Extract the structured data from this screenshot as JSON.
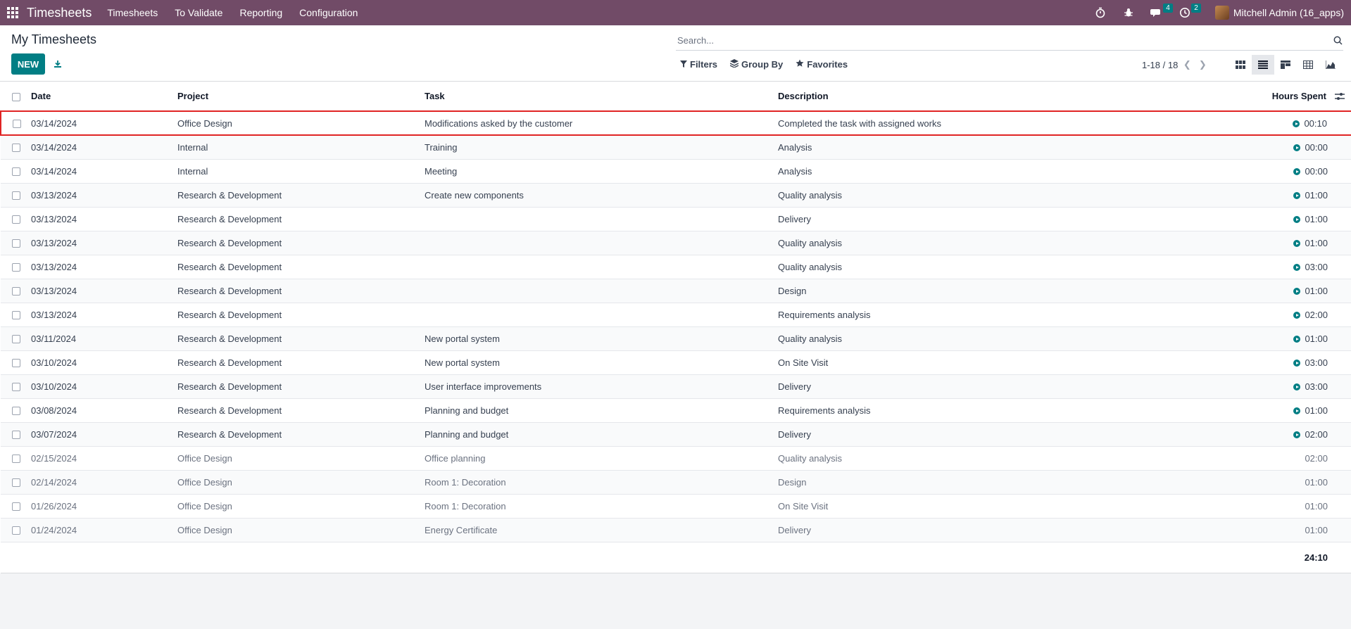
{
  "navbar": {
    "app_title": "Timesheets",
    "menu": [
      "Timesheets",
      "To Validate",
      "Reporting",
      "Configuration"
    ],
    "messages_count": "4",
    "activities_count": "2",
    "user_name": "Mitchell Admin (16_apps)"
  },
  "control": {
    "page_title": "My Timesheets",
    "new_label": "NEW",
    "search_placeholder": "Search...",
    "filters_label": "Filters",
    "groupby_label": "Group By",
    "favorites_label": "Favorites",
    "pager": "1-18 / 18"
  },
  "table": {
    "headers": {
      "date": "Date",
      "project": "Project",
      "task": "Task",
      "description": "Description",
      "hours": "Hours Spent"
    },
    "rows": [
      {
        "date": "03/14/2024",
        "project": "Office Design",
        "task": "Modifications asked by the customer",
        "description": "Completed the task with assigned works",
        "hours": "00:10",
        "timer": true,
        "selected": true
      },
      {
        "date": "03/14/2024",
        "project": "Internal",
        "task": "Training",
        "description": "Analysis",
        "hours": "00:00",
        "timer": true
      },
      {
        "date": "03/14/2024",
        "project": "Internal",
        "task": "Meeting",
        "description": "Analysis",
        "hours": "00:00",
        "timer": true
      },
      {
        "date": "03/13/2024",
        "project": "Research & Development",
        "task": "Create new components",
        "description": "Quality analysis",
        "hours": "01:00",
        "timer": true
      },
      {
        "date": "03/13/2024",
        "project": "Research & Development",
        "task": "",
        "description": "Delivery",
        "hours": "01:00",
        "timer": true
      },
      {
        "date": "03/13/2024",
        "project": "Research & Development",
        "task": "",
        "description": "Quality analysis",
        "hours": "01:00",
        "timer": true
      },
      {
        "date": "03/13/2024",
        "project": "Research & Development",
        "task": "",
        "description": "Quality analysis",
        "hours": "03:00",
        "timer": true
      },
      {
        "date": "03/13/2024",
        "project": "Research & Development",
        "task": "",
        "description": "Design",
        "hours": "01:00",
        "timer": true
      },
      {
        "date": "03/13/2024",
        "project": "Research & Development",
        "task": "",
        "description": "Requirements analysis",
        "hours": "02:00",
        "timer": true
      },
      {
        "date": "03/11/2024",
        "project": "Research & Development",
        "task": "New portal system",
        "description": "Quality analysis",
        "hours": "01:00",
        "timer": true
      },
      {
        "date": "03/10/2024",
        "project": "Research & Development",
        "task": "New portal system",
        "description": "On Site Visit",
        "hours": "03:00",
        "timer": true
      },
      {
        "date": "03/10/2024",
        "project": "Research & Development",
        "task": "User interface improvements",
        "description": "Delivery",
        "hours": "03:00",
        "timer": true
      },
      {
        "date": "03/08/2024",
        "project": "Research & Development",
        "task": "Planning and budget",
        "description": "Requirements analysis",
        "hours": "01:00",
        "timer": true
      },
      {
        "date": "03/07/2024",
        "project": "Research & Development",
        "task": "Planning and budget",
        "description": "Delivery",
        "hours": "02:00",
        "timer": true
      },
      {
        "date": "02/15/2024",
        "project": "Office Design",
        "task": "Office planning",
        "description": "Quality analysis",
        "hours": "02:00",
        "timer": false
      },
      {
        "date": "02/14/2024",
        "project": "Office Design",
        "task": "Room 1: Decoration",
        "description": "Design",
        "hours": "01:00",
        "timer": false
      },
      {
        "date": "01/26/2024",
        "project": "Office Design",
        "task": "Room 1: Decoration",
        "description": "On Site Visit",
        "hours": "01:00",
        "timer": false
      },
      {
        "date": "01/24/2024",
        "project": "Office Design",
        "task": "Energy Certificate",
        "description": "Delivery",
        "hours": "01:00",
        "timer": false
      }
    ],
    "total_hours": "24:10"
  },
  "colors": {
    "navbar": "#714b67",
    "primary": "#017e84",
    "highlight_border": "#e02424"
  },
  "icons": [
    "apps-grid-icon",
    "stopwatch-icon",
    "bug-icon",
    "chat-icon",
    "activity-clock-icon",
    "download-icon",
    "search-icon",
    "filter-icon",
    "layers-icon",
    "star-icon",
    "kanban-icon",
    "list-icon",
    "grid-icon",
    "pivot-icon",
    "graph-icon",
    "play-icon",
    "column-options-icon"
  ]
}
